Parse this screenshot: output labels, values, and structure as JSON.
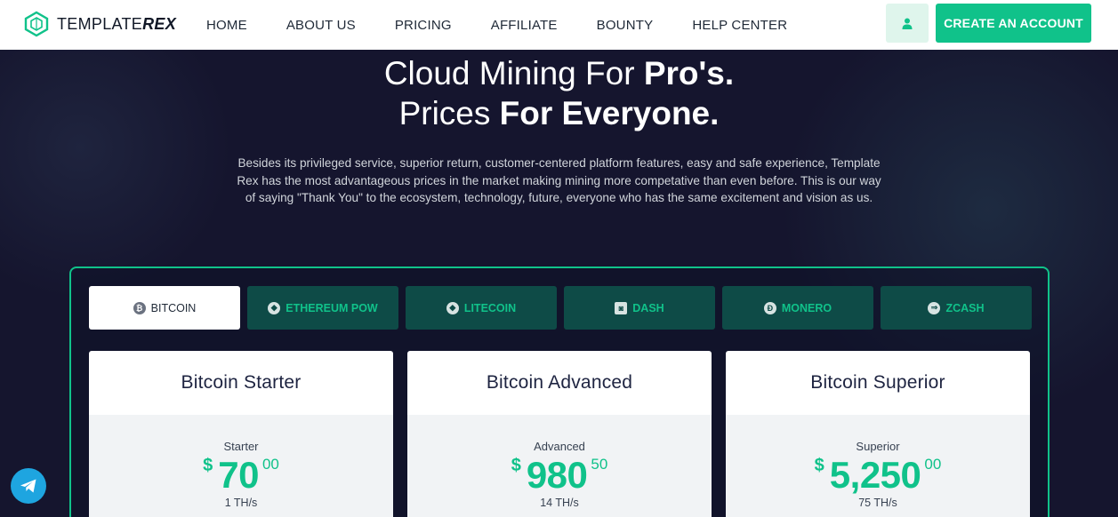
{
  "brand": {
    "logo_text_light": "TEMPLATE",
    "logo_text_bold": "REX",
    "accent": "#10c28a",
    "dark_bg": "#15152e"
  },
  "nav": {
    "links": [
      "HOME",
      "ABOUT US",
      "PRICING",
      "AFFILIATE",
      "BOUNTY",
      "HELP CENTER"
    ],
    "user_icon": "user-icon",
    "cta_label": "CREATE AN ACCOUNT"
  },
  "hero": {
    "title_line1_regular": "Cloud Mining For ",
    "title_line1_bold": "Pro's.",
    "title_line2_regular": "Prices ",
    "title_line2_bold": "For Everyone.",
    "description": "Besides its privileged service, superior return, customer-centered platform features, easy and safe experience, Template Rex has the most advantageous prices in the market making mining more competative than even before. This is our way of saying \"Thank You\" to the ecosystem, technology, future, everyone who has the same excitement and vision as us."
  },
  "tabs": [
    {
      "label": "BITCOIN",
      "icon": "bitcoin-icon",
      "glyph": "₿",
      "active": true
    },
    {
      "label": "ETHEREUM POW",
      "icon": "ethereum-icon",
      "glyph": "◆",
      "active": false
    },
    {
      "label": "LITECOIN",
      "icon": "litecoin-icon",
      "glyph": "◆",
      "active": false
    },
    {
      "label": "DASH",
      "icon": "dash-icon",
      "glyph": "◙",
      "active": false
    },
    {
      "label": "MONERO",
      "icon": "monero-icon",
      "glyph": "Đ",
      "active": false
    },
    {
      "label": "ZCASH",
      "icon": "zcash-icon",
      "glyph": "⇒",
      "active": false
    }
  ],
  "plans": [
    {
      "name": "Bitcoin Starter",
      "tag": "Starter",
      "currency": "$",
      "price": "70",
      "cents": "00",
      "hashrate": "1 TH/s"
    },
    {
      "name": "Bitcoin Advanced",
      "tag": "Advanced",
      "currency": "$",
      "price": "980",
      "cents": "50",
      "hashrate": "14 TH/s"
    },
    {
      "name": "Bitcoin Superior",
      "tag": "Superior",
      "currency": "$",
      "price": "5,250",
      "cents": "00",
      "hashrate": "75 TH/s"
    }
  ],
  "floating": {
    "icon": "telegram-icon"
  }
}
